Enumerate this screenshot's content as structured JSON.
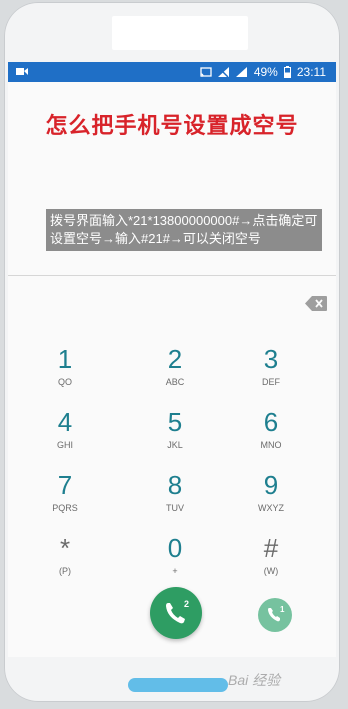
{
  "status_bar": {
    "battery": "49%",
    "time": "23:11"
  },
  "headline": "怎么把手机号设置成空号",
  "caption": "拨号界面输入*21*13800000000#→点击确定可设置空号→输入#21#→可以关闭空号",
  "keypad": [
    {
      "num": "1",
      "sub": "QO"
    },
    {
      "num": "2",
      "sub": "ABC"
    },
    {
      "num": "3",
      "sub": "DEF"
    },
    {
      "num": "4",
      "sub": "GHI"
    },
    {
      "num": "5",
      "sub": "JKL"
    },
    {
      "num": "6",
      "sub": "MNO"
    },
    {
      "num": "7",
      "sub": "PQRS"
    },
    {
      "num": "8",
      "sub": "TUV"
    },
    {
      "num": "9",
      "sub": "WXYZ"
    },
    {
      "num": "*",
      "sub": "(P)"
    },
    {
      "num": "0",
      "sub": "+"
    },
    {
      "num": "#",
      "sub": "(W)"
    }
  ],
  "call_buttons": {
    "primary_badge": "2",
    "secondary_badge": "1"
  },
  "watermark": "Bai 经验",
  "colors": {
    "accent": "#1e7f8f",
    "status_bar": "#1f6fc6",
    "call": "#2e9d63",
    "headline": "#d8232a"
  }
}
